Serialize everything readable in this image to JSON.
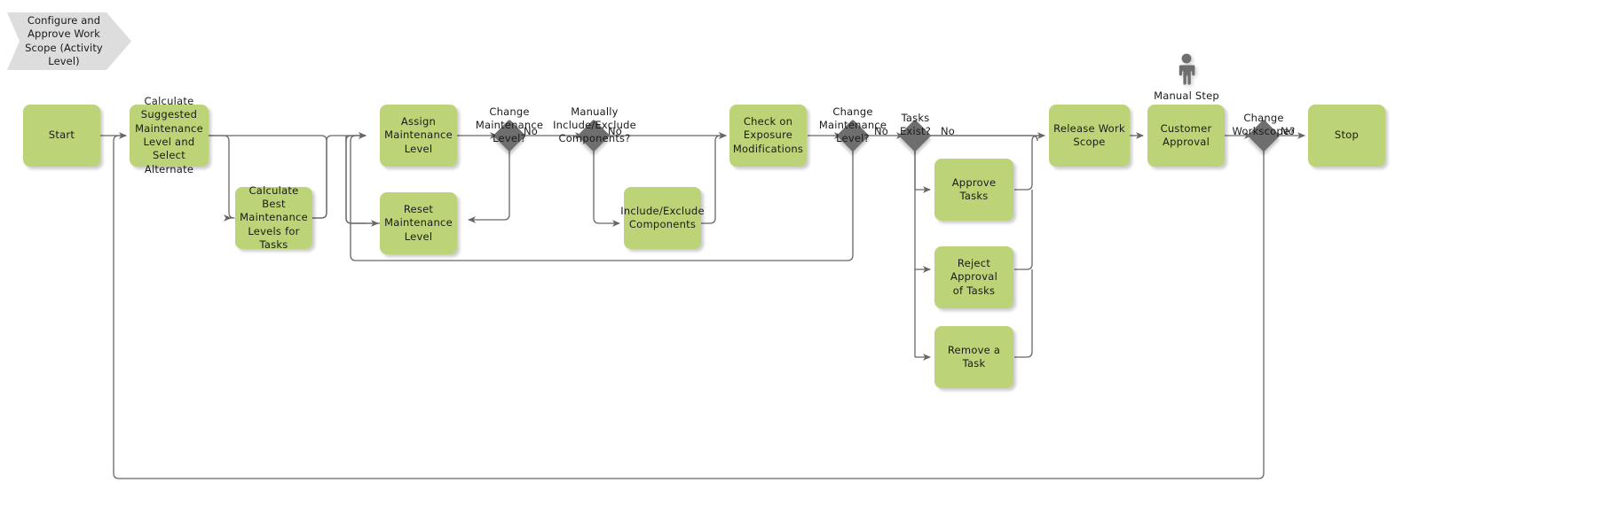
{
  "diagram": {
    "title_banner": {
      "lines": [
        "Configure and",
        "Approve Work",
        "Scope (Activity",
        "Level)"
      ]
    },
    "colors": {
      "task_fill": "#bcd477",
      "gateway_fill": "#6e6e6e",
      "banner_fill": "#dddddd",
      "connector_stroke": "#666666",
      "text": "#1a1a1a",
      "background": "#ffffff"
    },
    "nodes": [
      {
        "id": "start",
        "type": "task",
        "lines": [
          "Start"
        ]
      },
      {
        "id": "calc_suggested",
        "type": "task",
        "lines": [
          "Calculate",
          "Suggested",
          "Maintenance",
          "Level and Select",
          "Alternate"
        ]
      },
      {
        "id": "calc_best",
        "type": "task",
        "lines": [
          "Calculate Best",
          "Maintenance",
          "Levels for Tasks"
        ]
      },
      {
        "id": "assign_level",
        "type": "task",
        "lines": [
          "Assign",
          "Maintenance",
          "Level"
        ]
      },
      {
        "id": "reset_level",
        "type": "task",
        "lines": [
          "Reset",
          "Maintenance",
          "Level"
        ]
      },
      {
        "id": "include_exclude",
        "type": "task",
        "lines": [
          "Include/Exclude",
          "Components"
        ]
      },
      {
        "id": "check_exposure",
        "type": "task",
        "lines": [
          "Check on",
          "Exposure",
          "Modifications"
        ]
      },
      {
        "id": "approve_tasks",
        "type": "task",
        "lines": [
          "Approve Tasks"
        ]
      },
      {
        "id": "reject_approval",
        "type": "task",
        "lines": [
          "Reject Approval",
          "of Tasks"
        ]
      },
      {
        "id": "remove_task",
        "type": "task",
        "lines": [
          "Remove a Task"
        ]
      },
      {
        "id": "release_scope",
        "type": "task",
        "lines": [
          "Release Work",
          "Scope"
        ]
      },
      {
        "id": "customer_approval",
        "type": "task",
        "lines": [
          "Customer",
          "Approval"
        ]
      },
      {
        "id": "stop",
        "type": "task",
        "lines": [
          "Stop"
        ]
      }
    ],
    "gateways": [
      {
        "id": "gw_change_level_1",
        "label_lines": [
          "Change",
          "Maintenance",
          "Level?"
        ],
        "edge_label": "No"
      },
      {
        "id": "gw_manual_incexc",
        "label_lines": [
          "Manually",
          "Include/Exclude",
          "Components?"
        ],
        "edge_label": "No"
      },
      {
        "id": "gw_change_level_2",
        "label_lines": [
          "Change",
          "Maintenance",
          "Level?"
        ],
        "edge_label": "No"
      },
      {
        "id": "gw_tasks_exist",
        "label_lines": [
          "Tasks",
          "Exist?"
        ],
        "edge_label": "No"
      },
      {
        "id": "gw_change_scope",
        "label_lines": [
          "Change",
          "Workscope?"
        ],
        "edge_label": "No"
      }
    ],
    "annotations": [
      {
        "id": "manual_step",
        "icon": "person-icon",
        "caption": "Manual Step"
      }
    ]
  }
}
